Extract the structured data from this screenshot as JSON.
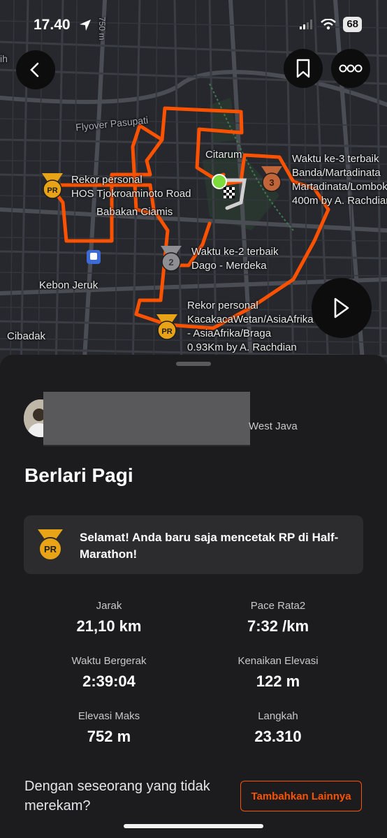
{
  "status_bar": {
    "time": "17.40",
    "battery": "68"
  },
  "map": {
    "labels": {
      "flyover": "Flyover Pasupati",
      "citarum": "Citarum",
      "babakan": "Babakan Ciamis",
      "kebon": "Kebon Jeruk",
      "cibadak": "Cibadak",
      "road750": "750 m",
      "edge_ih": "ih"
    },
    "segments": {
      "pr1_l1": "Rekor personal",
      "pr1_l2": "HOS Tjokroaminoto Road",
      "s2_l1": "Waktu ke-2 terbaik",
      "s2_l2": "Dago - Merdeka",
      "s3_l1": "Waktu ke-3 terbaik",
      "s3_l2": "Banda/Martadinata",
      "s3_l3": "Martadinata/Lombok",
      "s3_l4": "400m by A. Rachdian",
      "pr2_l1": "Rekor personal",
      "pr2_l2": "KacakacaWetan/AsiaAfrika",
      "pr2_l3": "- AsiaAfrika/Braga",
      "pr2_l4": "0.93Km by A. Rachdian"
    },
    "badges": {
      "pr": "PR",
      "second": "2",
      "third": "3"
    },
    "colors": {
      "route": "#fc5200",
      "gold": "#e8a317",
      "silver": "#8e8e93",
      "bronze": "#c0643a"
    }
  },
  "activity": {
    "location": "West Java",
    "title": "Berlari Pagi",
    "banner": {
      "text": "Selamat! Anda baru saja mencetak RP di Half-Marathon!",
      "badge": "PR"
    },
    "stats": [
      {
        "label": "Jarak",
        "value": "21,10 km"
      },
      {
        "label": "Pace Rata2",
        "value": "7:32 /km"
      },
      {
        "label": "Waktu Bergerak",
        "value": "2:39:04"
      },
      {
        "label": "Kenaikan Elevasi",
        "value": "122 m"
      },
      {
        "label": "Elevasi Maks",
        "value": "752 m"
      },
      {
        "label": "Langkah",
        "value": "23.310"
      }
    ],
    "question": "Dengan seseorang yang tidak merekam?",
    "add_button": "Tambahkan Lainnya"
  }
}
